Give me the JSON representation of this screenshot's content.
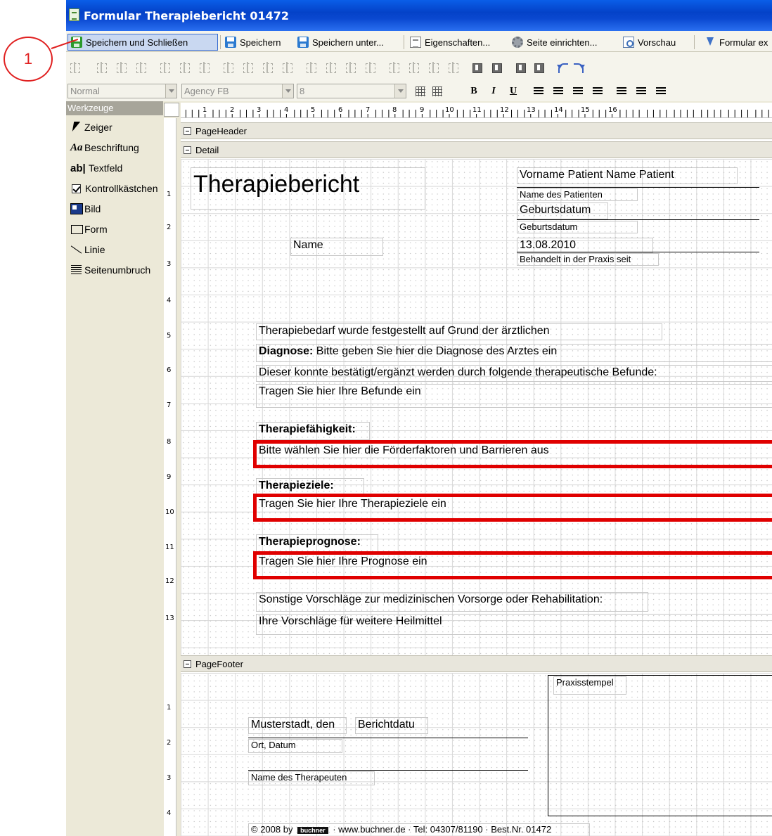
{
  "window": {
    "title": "Formular Therapiebericht 01472"
  },
  "toolbar": {
    "save_close": "Speichern und Schließen",
    "save": "Speichern",
    "save_as": "Speichern unter...",
    "properties": "Eigenschaften...",
    "page_setup": "Seite einrichten...",
    "preview": "Vorschau",
    "export": "Formular ex"
  },
  "format": {
    "style": "Normal",
    "font": "Agency FB",
    "size": "8",
    "bold": "B",
    "italic": "I",
    "underline": "U"
  },
  "tools": {
    "header": "Werkzeuge",
    "items": [
      "Zeiger",
      "Beschriftung",
      "Textfeld",
      "Kontrollkästchen",
      "Bild",
      "Form",
      "Linie",
      "Seitenumbruch"
    ]
  },
  "ruler": {
    "h": [
      "1",
      "2",
      "3",
      "4",
      "5",
      "6",
      "7",
      "8",
      "9",
      "10",
      "11",
      "12",
      "13",
      "14",
      "15",
      "16"
    ],
    "v_detail": [
      "1",
      "2",
      "3",
      "4",
      "5",
      "6",
      "7",
      "8",
      "9",
      "10",
      "11",
      "12",
      "13"
    ],
    "v_footer": [
      "1",
      "2",
      "3",
      "4"
    ]
  },
  "bands": {
    "header": "PageHeader",
    "detail": "Detail",
    "footer": "PageFooter"
  },
  "detail": {
    "title": "Therapiebericht",
    "patient_name_value": "Vorname Patient Name Patient",
    "patient_name_label": "Name des Patienten",
    "dob_value": "Geburtsdatum",
    "dob_label": "Geburtsdatum",
    "since_value": "13.08.2010",
    "since_label": "Behandelt in der Praxis seit",
    "name": "Name",
    "need_text": "Therapiebedarf wurde festgestellt auf Grund der ärztlichen",
    "diag_label": "Diagnose:",
    "diag_text": "Bitte geben Sie hier die Diagnose des Arztes ein",
    "confirm_text": "Dieser konnte bestätigt/ergänzt werden durch folgende therapeutische Befunde:",
    "findings": "Tragen Sie hier Ihre Befunde ein",
    "ability_label": "Therapiefähigkeit:",
    "ability_text": "Bitte wählen Sie hier die Förderfaktoren und Barrieren aus",
    "goals_label": "Therapieziele:",
    "goals_text": "Tragen Sie hier Ihre Therapieziele ein",
    "prognosis_label": "Therapieprognose:",
    "prognosis_text": "Tragen Sie hier Ihre Prognose ein",
    "other_text": "Sonstige Vorschläge zur medizinischen Vorsorge oder Rehabilitation:",
    "other_value": "Ihre Vorschläge für weitere Heilmittel"
  },
  "footer": {
    "stamp": "Praxisstempel",
    "city": "Musterstadt, den",
    "report_date": "Berichtdatu",
    "place_date": "Ort, Datum",
    "therapist": "Name des Therapeuten",
    "copyright": "© 2008 by",
    "brand": "buchner",
    "info": "· www.buchner.de · Tel: 04307/81190 · Best.Nr. 01472"
  },
  "callout": {
    "number": "1"
  }
}
